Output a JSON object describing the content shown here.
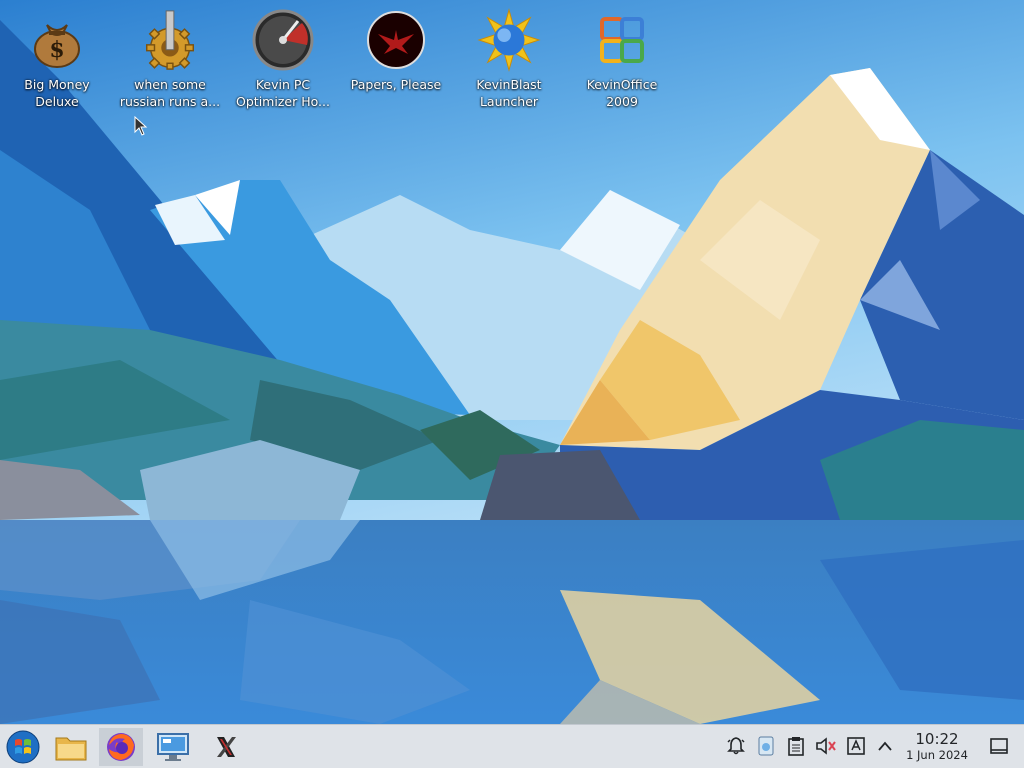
{
  "desktop": {
    "icons": [
      {
        "name": "big-money-deluxe",
        "label": "Big Money\nDeluxe",
        "icon": "money-bag-icon"
      },
      {
        "name": "russian-gear",
        "label": "when some\nrussian runs a...",
        "icon": "gear-icon"
      },
      {
        "name": "kevin-pc-optimizer",
        "label": "Kevin PC\nOptimizer Ho...",
        "icon": "speedometer-icon"
      },
      {
        "name": "papers-please",
        "label": "Papers, Please",
        "icon": "eagle-emblem-icon"
      },
      {
        "name": "kevinblast-launcher",
        "label": "KevinBlast\nLauncher",
        "icon": "sun-globe-icon"
      },
      {
        "name": "kevinoffice-2009",
        "label": "KevinOffice\n2009",
        "icon": "office-logo-icon"
      }
    ]
  },
  "taskbar": {
    "launchers": [
      {
        "name": "start-menu-button",
        "icon": "windows-orb-icon"
      },
      {
        "name": "file-manager-button",
        "icon": "folder-icon"
      },
      {
        "name": "firefox-button",
        "icon": "firefox-icon",
        "active": true
      },
      {
        "name": "control-panel-button",
        "icon": "computer-monitor-icon"
      },
      {
        "name": "x-app-button",
        "icon": "x-icon"
      }
    ],
    "tray": [
      {
        "name": "notifications-icon"
      },
      {
        "name": "network-icon"
      },
      {
        "name": "clipboard-icon"
      },
      {
        "name": "volume-muted-icon"
      },
      {
        "name": "keyboard-layout-icon"
      },
      {
        "name": "show-hidden-icons"
      }
    ],
    "clock": {
      "time": "10:22",
      "date": "1 Jun 2024"
    },
    "show_desktop": "show-desktop-icon"
  },
  "colors": {
    "taskbar_bg": "#dfe3e8",
    "sky_top": "#3a8fd6",
    "sky_bottom": "#c9e6f8",
    "water": "#3f7fbf"
  }
}
